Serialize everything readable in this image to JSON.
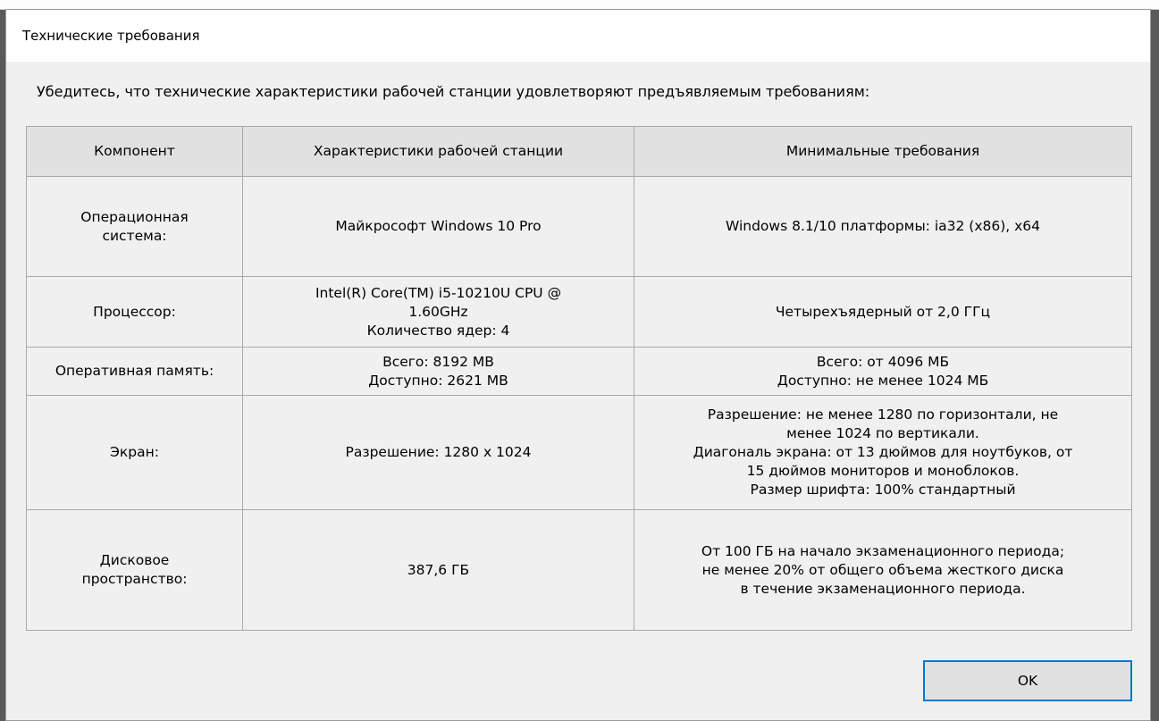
{
  "dialog": {
    "title": "Технические требования",
    "intro": "Убедитесь, что технические характеристики рабочей станции удовлетворяют предъявляемым требованиям:",
    "ok_label": "OK"
  },
  "table": {
    "headers": [
      "Компонент",
      "Характеристики рабочей станции",
      "Минимальные требования"
    ],
    "rows": [
      {
        "component": "Операционная\nсистема:",
        "workstation": "Майкрософт Windows 10 Pro",
        "minimum": "Windows 8.1/10 платформы: ia32 (x86), x64"
      },
      {
        "component": "Процессор:",
        "workstation": "Intel(R) Core(TM) i5-10210U CPU @\n1.60GHz\nКоличество ядер: 4",
        "minimum": "Четырехъядерный от 2,0 ГГц"
      },
      {
        "component": "Оперативная память:",
        "workstation": "Всего: 8192 MB\nДоступно: 2621 MB",
        "minimum": "Всего: от 4096 МБ\nДоступно: не менее 1024 МБ"
      },
      {
        "component": "Экран:",
        "workstation": "Разрешение: 1280 x 1024",
        "minimum": "Разрешение: не менее 1280 по горизонтали, не\nменее 1024 по вертикали.\nДиагональ экрана: от 13 дюймов для ноутбуков, от\n15 дюймов мониторов и моноблоков.\nРазмер шрифта: 100% стандартный"
      },
      {
        "component": "Дисковое\nпространство:",
        "workstation": "387,6 ГБ",
        "minimum": "От 100 ГБ на начало экзаменационного периода;\nне менее 20% от общего объема жесткого диска\nв течение экзаменационного периода."
      }
    ]
  },
  "colors": {
    "dialog_bg": "#f0f0f0",
    "header_bg": "#e1e1e1",
    "border": "#a9a9a9",
    "button_focus": "#0078d7"
  }
}
